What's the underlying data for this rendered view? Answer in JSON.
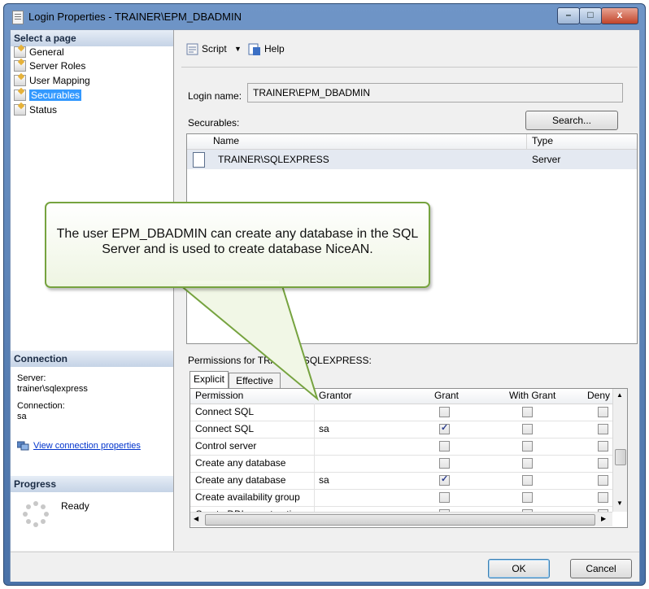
{
  "window": {
    "title": "Login Properties - TRAINER\\EPM_DBADMIN",
    "buttons": {
      "minimize": "–",
      "maximize": "□",
      "close": "x"
    }
  },
  "sidebar": {
    "select_page_header": "Select a page",
    "pages": [
      {
        "label": "General",
        "selected": false
      },
      {
        "label": "Server Roles",
        "selected": false
      },
      {
        "label": "User Mapping",
        "selected": false
      },
      {
        "label": "Securables",
        "selected": true
      },
      {
        "label": "Status",
        "selected": false
      }
    ],
    "connection": {
      "header": "Connection",
      "server_label": "Server:",
      "server_value": "trainer\\sqlexpress",
      "connection_label": "Connection:",
      "connection_value": "sa",
      "view_link": "View connection properties"
    },
    "progress": {
      "header": "Progress",
      "status": "Ready"
    }
  },
  "toolbar": {
    "script_label": "Script",
    "help_label": "Help"
  },
  "main": {
    "login_name_label": "Login name:",
    "login_name_value": "TRAINER\\EPM_DBADMIN",
    "securables_label": "Securables:",
    "search_button": "Search...",
    "securables_columns": {
      "name": "Name",
      "type": "Type"
    },
    "securables_rows": [
      {
        "name": "TRAINER\\SQLEXPRESS",
        "type": "Server"
      }
    ],
    "permissions_label": "Permissions for TRAINER\\SQLEXPRESS:",
    "tabs": {
      "explicit": "Explicit",
      "effective": "Effective"
    },
    "perm_columns": {
      "permission": "Permission",
      "grantor": "Grantor",
      "grant": "Grant",
      "with_grant": "With Grant",
      "deny": "Deny"
    },
    "perm_rows": [
      {
        "permission": "Connect SQL",
        "grantor": "",
        "grant": false,
        "with_grant": false,
        "deny": false
      },
      {
        "permission": "Connect SQL",
        "grantor": "sa",
        "grant": true,
        "with_grant": false,
        "deny": false
      },
      {
        "permission": "Control server",
        "grantor": "",
        "grant": false,
        "with_grant": false,
        "deny": false
      },
      {
        "permission": "Create any database",
        "grantor": "",
        "grant": false,
        "with_grant": false,
        "deny": false
      },
      {
        "permission": "Create any database",
        "grantor": "sa",
        "grant": true,
        "with_grant": false,
        "deny": false
      },
      {
        "permission": "Create availability group",
        "grantor": "",
        "grant": false,
        "with_grant": false,
        "deny": false
      },
      {
        "permission": "Create DDL event noti...",
        "grantor": "",
        "grant": false,
        "with_grant": false,
        "deny": false
      }
    ]
  },
  "footer": {
    "ok_button": "OK",
    "cancel_button": "Cancel"
  },
  "callout": {
    "text": "The user EPM_DBADMIN can create any database in the SQL Server and is used to create database NiceAN."
  }
}
